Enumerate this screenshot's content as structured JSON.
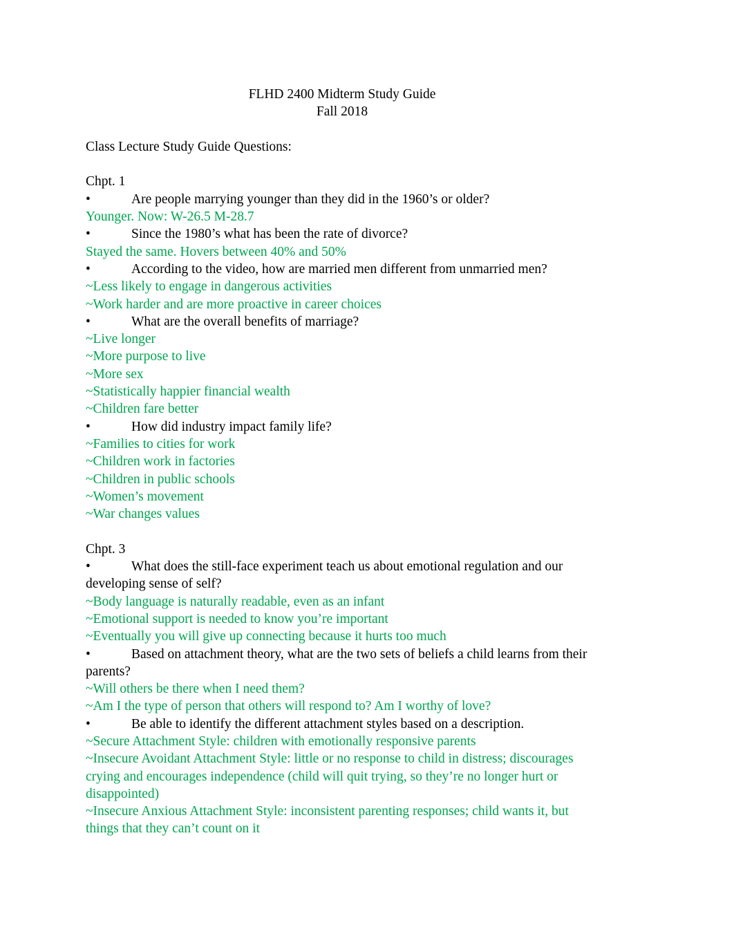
{
  "document": {
    "title_lines": [
      "FLHD 2400 Midterm Study Guide",
      "Fall 2018"
    ],
    "intro": "Class Lecture Study Guide Questions:",
    "bullet_glyph": "•",
    "colors": {
      "text": "#000000",
      "answer_green": "#00a550",
      "page_background": "#ffffff"
    },
    "sections": [
      {
        "heading": "Chpt. 1",
        "blocks": [
          {
            "kind": "question",
            "text": "Are people marrying younger than they did in the 1960’s or older?"
          },
          {
            "kind": "answer",
            "text": "Younger. Now: W-26.5 M-28.7"
          },
          {
            "kind": "question",
            "text": "Since the 1980’s what has been the rate of divorce?"
          },
          {
            "kind": "answer",
            "text": "Stayed the same. Hovers between 40% and 50%"
          },
          {
            "kind": "question",
            "text": "According to the video, how are married men different from unmarried men?"
          },
          {
            "kind": "answer",
            "text": "~Less likely to engage in dangerous activities"
          },
          {
            "kind": "answer",
            "text": "~Work harder and are more proactive in career choices"
          },
          {
            "kind": "question",
            "text": "What are the overall benefits of marriage?"
          },
          {
            "kind": "answer",
            "text": "~Live longer"
          },
          {
            "kind": "answer",
            "text": "~More purpose to live"
          },
          {
            "kind": "answer",
            "text": "~More sex"
          },
          {
            "kind": "answer",
            "text": "~Statistically happier financial wealth"
          },
          {
            "kind": "answer",
            "text": "~Children fare better"
          },
          {
            "kind": "question",
            "text": "How did industry impact family life?"
          },
          {
            "kind": "answer",
            "text": "~Families to cities for work"
          },
          {
            "kind": "answer",
            "text": "~Children work in factories"
          },
          {
            "kind": "answer",
            "text": "~Children in public schools"
          },
          {
            "kind": "answer",
            "text": "~Women’s movement"
          },
          {
            "kind": "answer",
            "text": "~War changes values"
          }
        ]
      },
      {
        "heading": "Chpt. 3",
        "blocks": [
          {
            "kind": "question",
            "text": "What does the still-face experiment teach us about emotional regulation and our developing sense of self?"
          },
          {
            "kind": "answer",
            "text": "~Body language is naturally readable, even as an infant"
          },
          {
            "kind": "answer",
            "text": "~Emotional support is needed to know you’re important"
          },
          {
            "kind": "answer",
            "text": "~Eventually you will give up connecting because it hurts too much"
          },
          {
            "kind": "question",
            "text": "Based on attachment theory, what are the two sets of beliefs a child learns from their parents?"
          },
          {
            "kind": "answer",
            "text": "~Will others be there when I need them?"
          },
          {
            "kind": "answer",
            "text": "~Am I the type of person that others will respond to? Am I worthy of love?"
          },
          {
            "kind": "question",
            "text": "Be able to identify the different attachment styles based on a description."
          },
          {
            "kind": "answer",
            "text": "~Secure Attachment Style: children with emotionally responsive parents"
          },
          {
            "kind": "answer",
            "text": "~Insecure Avoidant Attachment Style: little or no response to child in distress; discourages crying and encourages independence (child will quit trying, so they’re no longer hurt or disappointed)"
          },
          {
            "kind": "answer",
            "text": "~Insecure Anxious Attachment Style: inconsistent parenting responses; child wants it, but things that they can’t count on it"
          }
        ]
      }
    ]
  }
}
